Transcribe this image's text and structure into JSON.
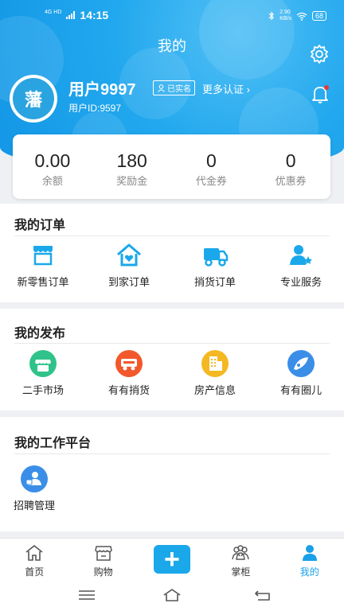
{
  "status_bar": {
    "signal_tag": "4G HD",
    "time": "14:15",
    "speed_value": "2.90",
    "speed_unit": "KB/s",
    "battery": "68"
  },
  "header": {
    "title": "我的"
  },
  "user": {
    "avatar_text": "藩",
    "name": "用户9997",
    "verified_label": "已实名",
    "more_auth_label": "更多认证 ›",
    "id_text": "用户ID:9597"
  },
  "stats": [
    {
      "value": "0.00",
      "label": "余额"
    },
    {
      "value": "180",
      "label": "奖励金"
    },
    {
      "value": "0",
      "label": "代金券"
    },
    {
      "value": "0",
      "label": "优惠券"
    }
  ],
  "orders": {
    "title": "我的订单",
    "items": [
      {
        "label": "新零售订单",
        "icon": "store-icon"
      },
      {
        "label": "到家订单",
        "icon": "home-heart-icon"
      },
      {
        "label": "捎货订单",
        "icon": "truck-icon"
      },
      {
        "label": "专业服务",
        "icon": "professional-service-icon"
      }
    ]
  },
  "publish": {
    "title": "我的发布",
    "items": [
      {
        "label": "二手市场",
        "icon": "secondhand-market-icon"
      },
      {
        "label": "有有捎货",
        "icon": "delivery-icon"
      },
      {
        "label": "房产信息",
        "icon": "real-estate-icon"
      },
      {
        "label": "有有圈儿",
        "icon": "circle-icon"
      }
    ]
  },
  "workbench": {
    "title": "我的工作平台",
    "items": [
      {
        "label": "招聘管理",
        "icon": "recruitment-icon"
      }
    ]
  },
  "tabbar": [
    {
      "label": "首页",
      "icon": "home-icon"
    },
    {
      "label": "购物",
      "icon": "shop-icon"
    },
    {
      "label": "",
      "icon": "plus-icon"
    },
    {
      "label": "掌柜",
      "icon": "shopkeeper-icon"
    },
    {
      "label": "我的",
      "icon": "profile-icon",
      "active": true
    }
  ],
  "colors": {
    "accent": "#1aa8ea",
    "header_blue": "#22a8ee",
    "notify_red": "#e53935"
  }
}
